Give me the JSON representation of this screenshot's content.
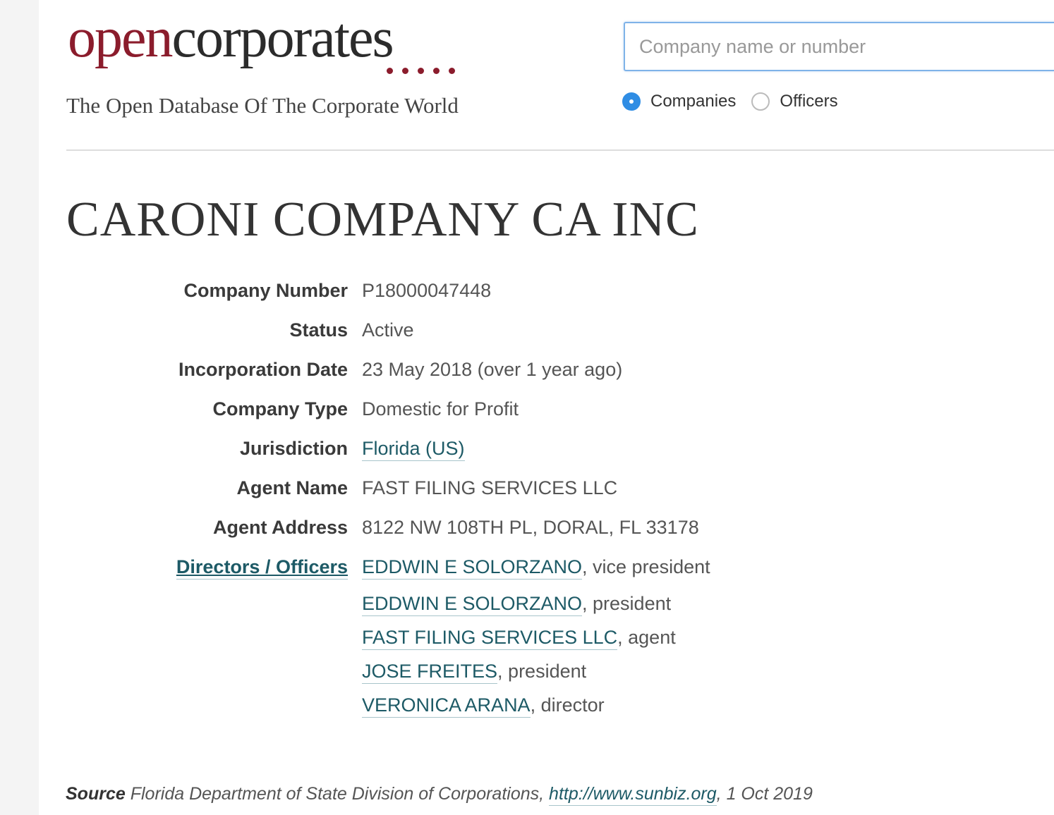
{
  "header": {
    "logo_open": "open",
    "logo_corporates": "corporates",
    "tagline": "The Open Database Of The Corporate World",
    "search": {
      "placeholder": "Company name or number",
      "value": ""
    },
    "search_types": [
      {
        "label": "Companies",
        "selected": true
      },
      {
        "label": "Officers",
        "selected": false
      }
    ]
  },
  "company": {
    "name": "CARONI COMPANY CA INC",
    "attributes": [
      {
        "label": "Company Number",
        "value": "P18000047448"
      },
      {
        "label": "Status",
        "value": "Active"
      },
      {
        "label": "Incorporation Date",
        "value": "23 May 2018 (over 1 year ago)"
      },
      {
        "label": "Company Type",
        "value": "Domestic for Profit"
      },
      {
        "label": "Jurisdiction",
        "value": "Florida (US)",
        "is_link": true
      },
      {
        "label": "Agent Name",
        "value": "FAST FILING SERVICES LLC"
      },
      {
        "label": "Agent Address",
        "value": "8122 NW 108TH PL, DORAL, FL 33178"
      }
    ],
    "officers_label": "Directors / Officers",
    "officers": [
      {
        "name": "EDDWIN E SOLORZANO",
        "role": ", vice president"
      },
      {
        "name": "EDDWIN E SOLORZANO",
        "role": ", president"
      },
      {
        "name": "FAST FILING SERVICES LLC",
        "role": ", agent"
      },
      {
        "name": "JOSE FREITES",
        "role": ", president"
      },
      {
        "name": "VERONICA ARANA",
        "role": ", director"
      }
    ]
  },
  "source": {
    "label": "Source",
    "text": " Florida Department of State Division of Corporations, ",
    "url": "http://www.sunbiz.org",
    "date": ", 1 Oct 2019"
  },
  "colors": {
    "brand": "#8b1c2c",
    "link": "#1d5a66",
    "radio_selected": "#2f8de4"
  }
}
